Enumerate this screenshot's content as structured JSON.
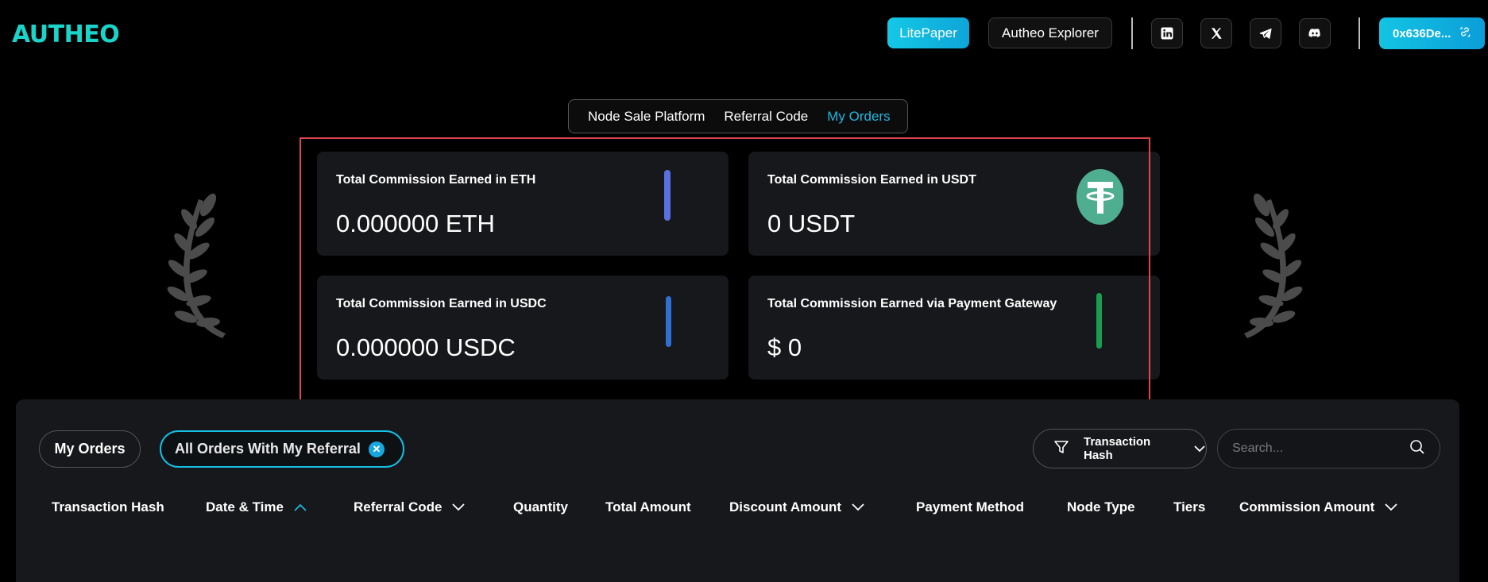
{
  "header": {
    "logo": "AUTHEO",
    "litepaper_label": "LitePaper",
    "explorer_label": "Autheo Explorer",
    "social": [
      "linkedin-icon",
      "x-icon",
      "telegram-icon",
      "discord-icon"
    ],
    "wallet_label": "0x636De..."
  },
  "tabs": [
    {
      "label": "Node Sale Platform",
      "active": false
    },
    {
      "label": "Referral Code",
      "active": false
    },
    {
      "label": "My Orders",
      "active": true
    }
  ],
  "cards": [
    {
      "title": "Total Commission Earned in ETH",
      "value": "0.000000 ETH",
      "icon": "eth-icon"
    },
    {
      "title": "Total Commission Earned in USDT",
      "value": "0 USDT",
      "icon": "usdt-icon"
    },
    {
      "title": "Total Commission Earned in USDC",
      "value": "0.000000 USDC",
      "icon": "usdc-icon"
    },
    {
      "title": "Total Commission Earned via Payment Gateway",
      "value": "$ 0",
      "icon": "gateway-icon"
    }
  ],
  "orders": {
    "my_orders_label": "My Orders",
    "all_orders_label": "All Orders With My Referral",
    "filter_label": "Transaction Hash",
    "search_placeholder": "Search...",
    "columns": [
      "Transaction Hash",
      "Date & Time",
      "Referral Code",
      "Quantity",
      "Total Amount",
      "Discount Amount",
      "Payment Method",
      "Node Type",
      "Tiers",
      "Commission Amount"
    ]
  },
  "colors": {
    "accent": "#14c8e6",
    "highlight": "#e0454d",
    "card_bg": "#17181b",
    "usdt": "#4fae8f"
  }
}
